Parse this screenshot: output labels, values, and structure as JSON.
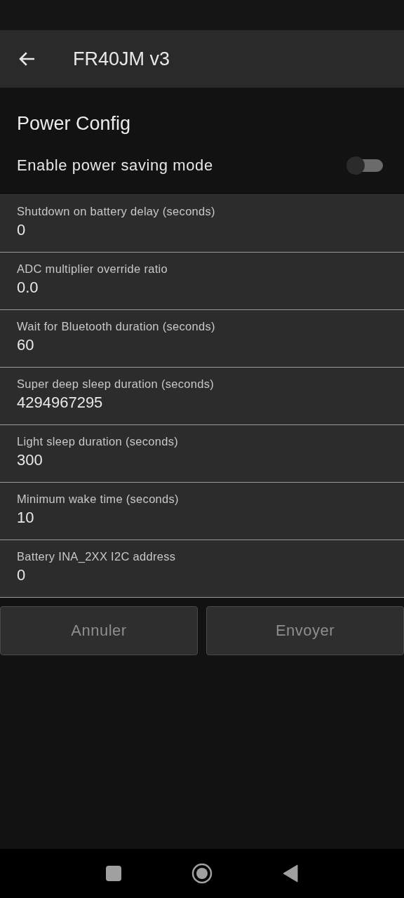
{
  "app_bar": {
    "title": "FR40JM v3"
  },
  "section_title": "Power Config",
  "toggle": {
    "label": "Enable power saving mode",
    "on": false
  },
  "fields": [
    {
      "label": "Shutdown on battery delay (seconds)",
      "value": "0"
    },
    {
      "label": "ADC multiplier override ratio",
      "value": "0.0"
    },
    {
      "label": "Wait for Bluetooth duration (seconds)",
      "value": "60"
    },
    {
      "label": "Super deep sleep duration (seconds)",
      "value": "4294967295"
    },
    {
      "label": "Light sleep duration (seconds)",
      "value": "300"
    },
    {
      "label": "Minimum wake time (seconds)",
      "value": "10"
    },
    {
      "label": "Battery INA_2XX I2C address",
      "value": "0"
    }
  ],
  "buttons": [
    {
      "label": "Annuler",
      "disabled": true
    },
    {
      "label": "Envoyer",
      "disabled": true
    }
  ]
}
